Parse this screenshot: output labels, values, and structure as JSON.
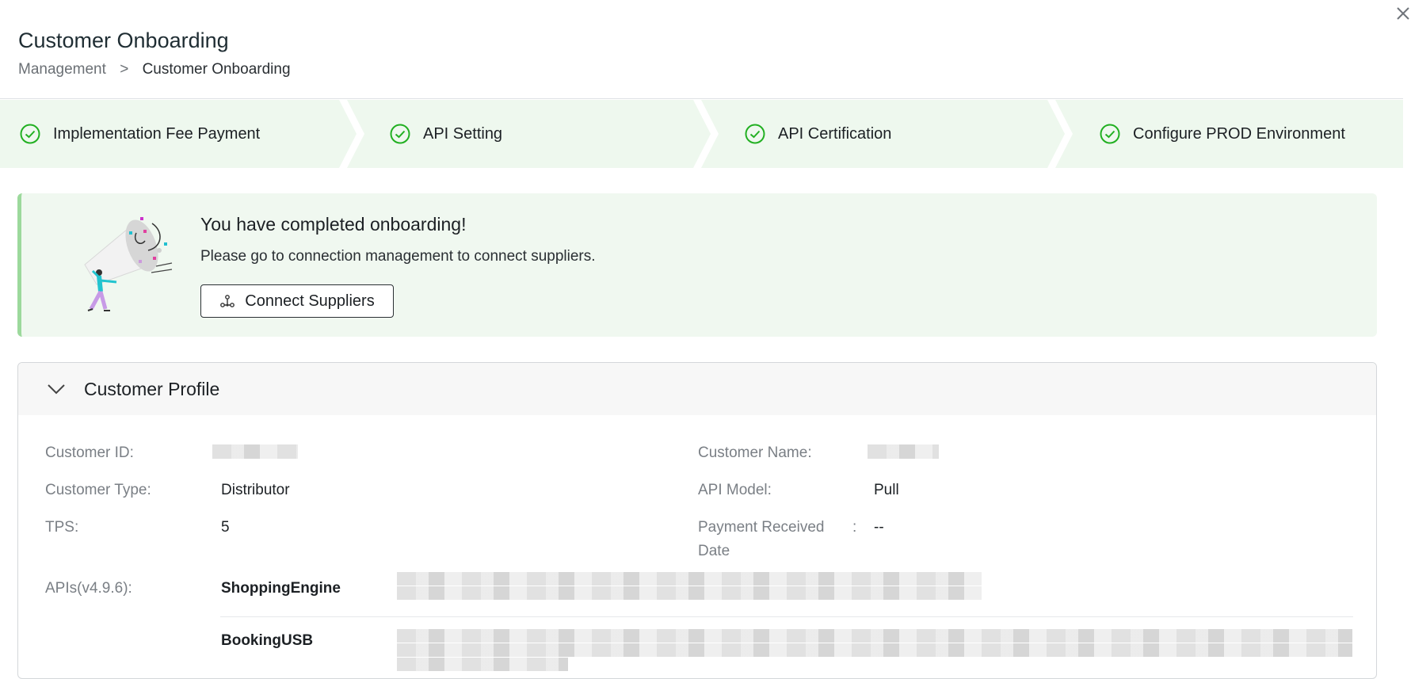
{
  "header": {
    "title": "Customer Onboarding",
    "breadcrumb": [
      "Management",
      "Customer Onboarding"
    ],
    "breadcrumb_sep": ">",
    "close_icon": "close-icon"
  },
  "steps": [
    {
      "label": "Implementation Fee Payment",
      "status": "done"
    },
    {
      "label": "API Setting",
      "status": "done"
    },
    {
      "label": "API Certification",
      "status": "done"
    },
    {
      "label": "Configure PROD Environment",
      "status": "done"
    }
  ],
  "banner": {
    "title": "You have completed onboarding!",
    "message": "Please go to connection management to connect suppliers.",
    "button_label": "Connect Suppliers",
    "button_icon": "network-nodes-icon",
    "illustration": "megaphone-celebration-illustration"
  },
  "profile": {
    "section_title": "Customer Profile",
    "fields": {
      "customer_id_label": "Customer ID:",
      "customer_name_label": "Customer Name:",
      "customer_type_label": "Customer Type:",
      "customer_type_value": "Distributor",
      "api_model_label": "API Model:",
      "api_model_value": "Pull",
      "tps_label": "TPS:",
      "tps_value": "5",
      "payment_received_label_line1": "Payment Received",
      "payment_received_label_line2": "Date",
      "payment_received_colon": ":",
      "payment_received_value": "--",
      "apis_label": "APIs(v4.9.6):"
    },
    "apis": [
      {
        "name": "ShoppingEngine"
      },
      {
        "name": "BookingUSB"
      }
    ]
  },
  "colors": {
    "accent_green": "#22b022",
    "step_bg": "#eef8ee",
    "banner_bg": "#f0f8f0",
    "banner_border": "#9cd99c"
  }
}
